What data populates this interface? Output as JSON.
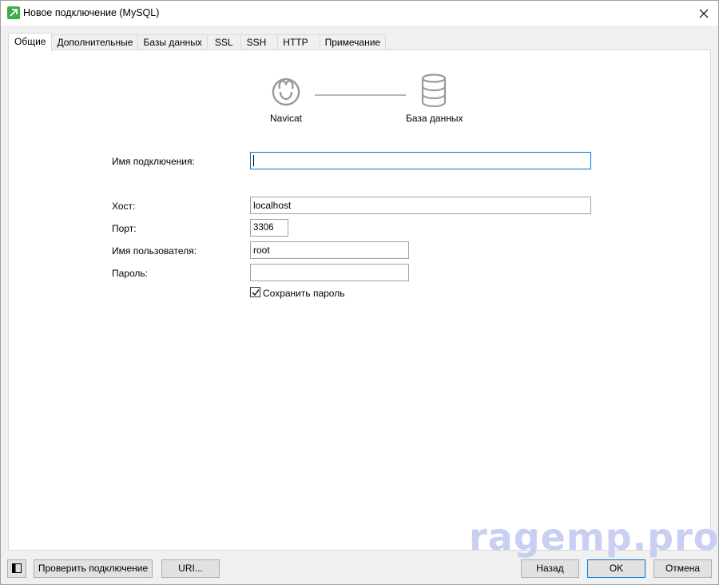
{
  "window": {
    "title": "Новое подключение (MySQL)"
  },
  "tabs": [
    {
      "label": "Общие",
      "active": true
    },
    {
      "label": "Дополнительные"
    },
    {
      "label": "Базы данных"
    },
    {
      "label": "SSL"
    },
    {
      "label": "SSH"
    },
    {
      "label": "HTTP"
    },
    {
      "label": "Примечание"
    }
  ],
  "diagram": {
    "left_label": "Navicat",
    "right_label": "База данных"
  },
  "form": {
    "connection_name": {
      "label": "Имя подключения:",
      "value": ""
    },
    "host": {
      "label": "Хост:",
      "value": "localhost"
    },
    "port": {
      "label": "Порт:",
      "value": "3306"
    },
    "username": {
      "label": "Имя пользователя:",
      "value": "root"
    },
    "password": {
      "label": "Пароль:",
      "value": ""
    },
    "save_password": {
      "label": "Сохранить пароль",
      "checked": true
    }
  },
  "footer": {
    "test_connection": "Проверить подключение",
    "uri": "URI...",
    "back": "Назад",
    "ok": "OK",
    "cancel": "Отмена"
  },
  "watermark": "ragemp.pro",
  "colors": {
    "accent": "#0078d7",
    "app_icon": "#3fae49"
  }
}
